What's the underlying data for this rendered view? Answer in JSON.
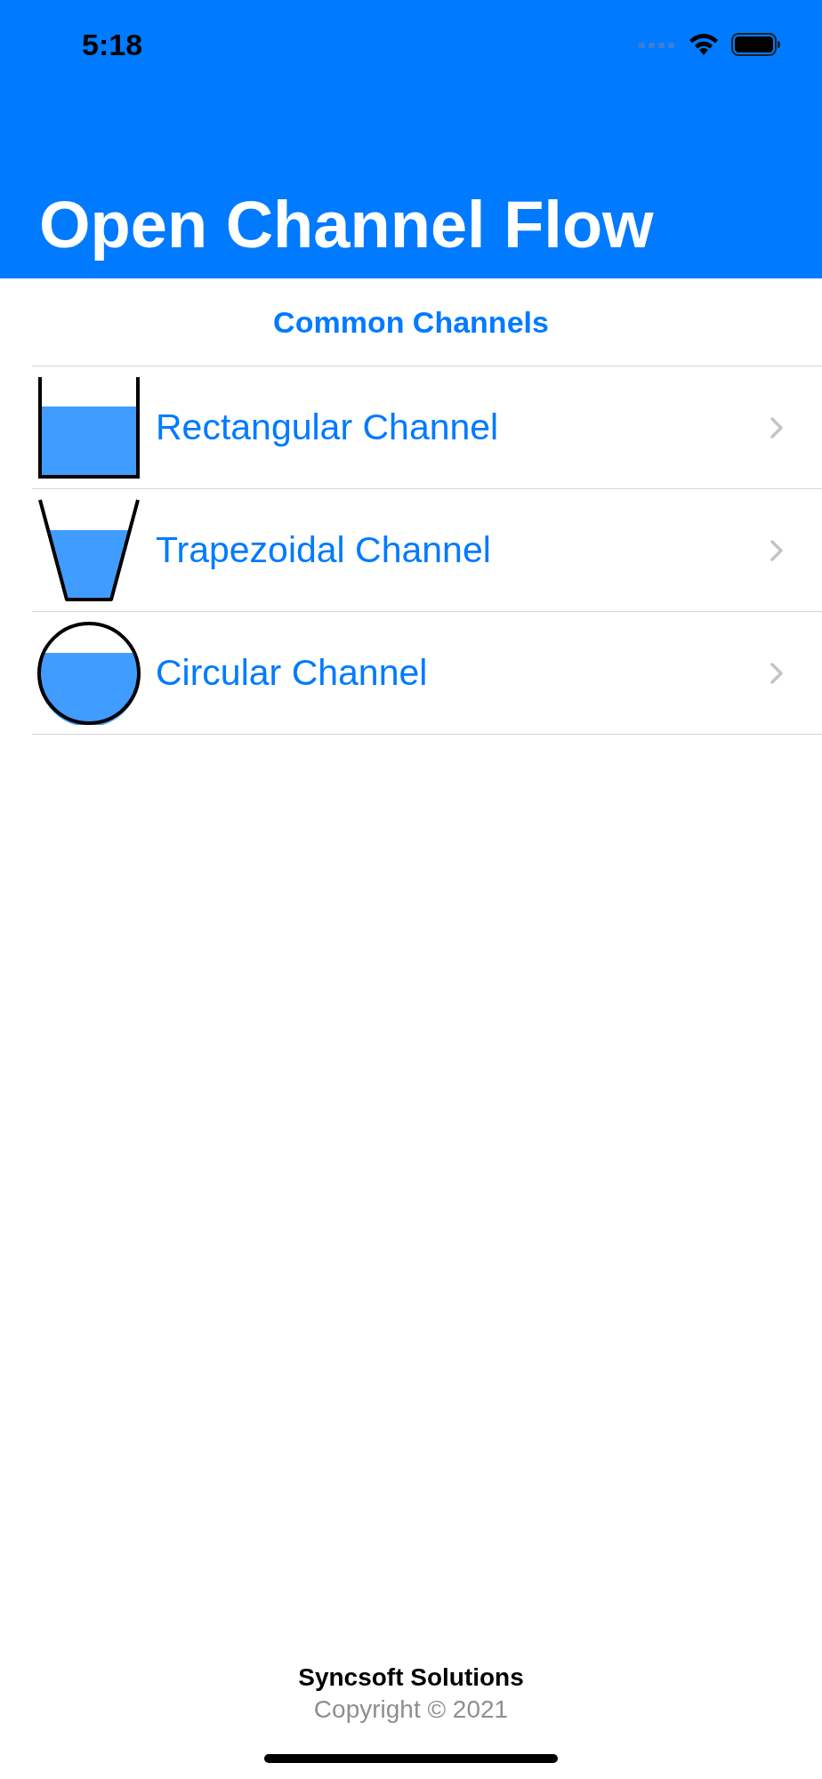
{
  "status_bar": {
    "time": "5:18"
  },
  "navigation": {
    "title": "Open Channel Flow"
  },
  "section": {
    "title": "Common Channels"
  },
  "channels": [
    {
      "kind": "rectangular",
      "label": "Rectangular Channel"
    },
    {
      "kind": "trapezoidal",
      "label": "Trapezoidal Channel"
    },
    {
      "kind": "circular",
      "label": "Circular Channel"
    }
  ],
  "footer": {
    "company": "Syncsoft Solutions",
    "copyright": "Copyright © 2021"
  }
}
